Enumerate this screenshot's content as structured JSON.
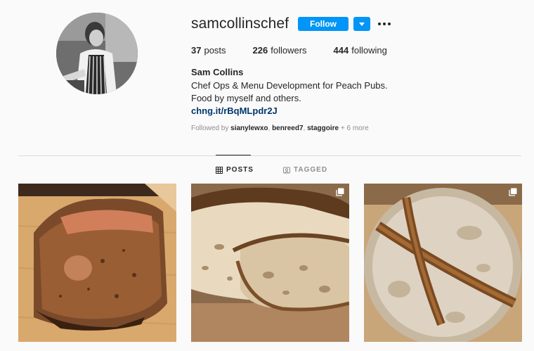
{
  "profile": {
    "username": "samcollinschef",
    "follow_label": "Follow",
    "full_name": "Sam Collins",
    "bio_lines": [
      "Chef Ops & Menu Development for Peach Pubs.",
      "Food by myself and others."
    ],
    "link": "chng.it/rBqMLpdr2J"
  },
  "stats": {
    "posts_count": "37",
    "posts_label": "posts",
    "followers_count": "226",
    "followers_label": "followers",
    "following_count": "444",
    "following_label": "following"
  },
  "followed_by": {
    "prefix": "Followed by ",
    "users": [
      "sianylewxo",
      "benreed7",
      "staggoire"
    ],
    "more": " + 6 more"
  },
  "tabs": [
    {
      "label": "POSTS",
      "icon": "grid-icon",
      "active": true
    },
    {
      "label": "TAGGED",
      "icon": "tagged-icon",
      "active": false
    }
  ],
  "posts": [
    {
      "subject": "roast pork belly",
      "multi": false
    },
    {
      "subject": "sourdough loaf crumb",
      "multi": true
    },
    {
      "subject": "sourdough loaf crust",
      "multi": true
    }
  ],
  "colors": {
    "accent": "#0095f6",
    "link": "#00376b",
    "muted": "#8e8e8e"
  }
}
